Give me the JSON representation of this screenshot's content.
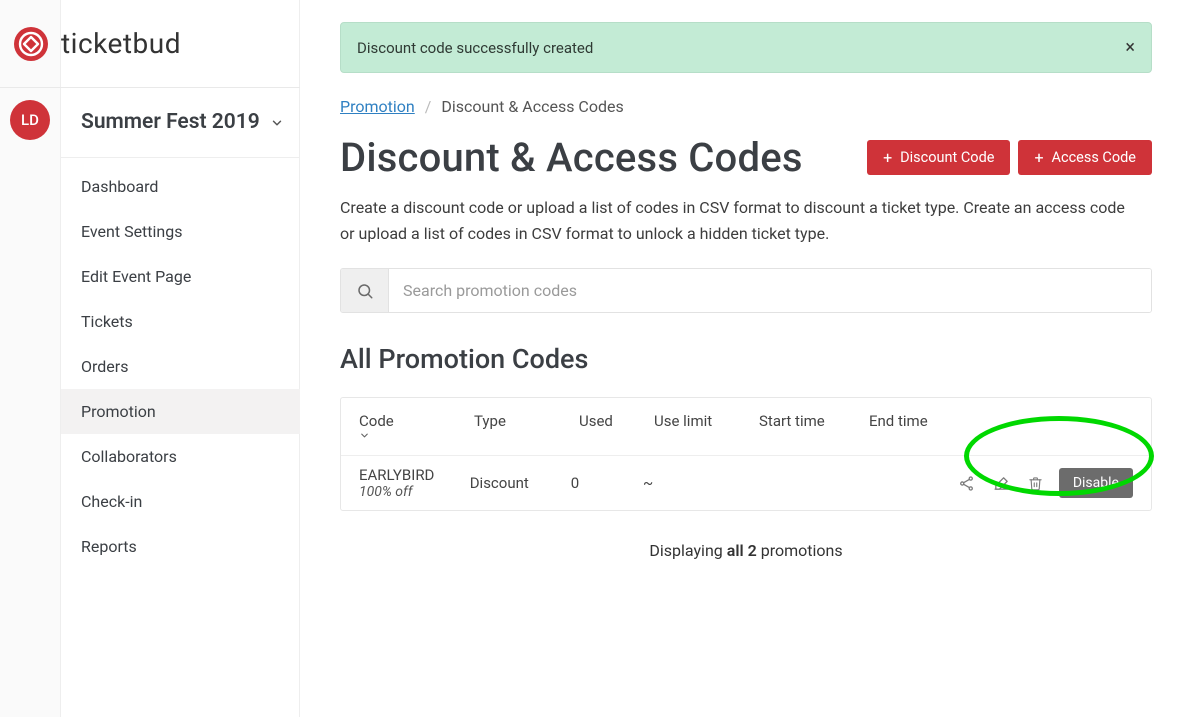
{
  "brand": {
    "name": "ticketbud"
  },
  "user": {
    "initials": "LD"
  },
  "event_switcher": {
    "title": "Summer Fest 2019"
  },
  "sidebar": {
    "items": [
      {
        "label": "Dashboard",
        "active": false
      },
      {
        "label": "Event Settings",
        "active": false
      },
      {
        "label": "Edit Event Page",
        "active": false
      },
      {
        "label": "Tickets",
        "active": false
      },
      {
        "label": "Orders",
        "active": false
      },
      {
        "label": "Promotion",
        "active": true
      },
      {
        "label": "Collaborators",
        "active": false
      },
      {
        "label": "Check-in",
        "active": false
      },
      {
        "label": "Reports",
        "active": false
      }
    ]
  },
  "flash": {
    "message": "Discount code successfully created"
  },
  "breadcrumb": {
    "link": "Promotion",
    "sep": "/",
    "current": "Discount & Access Codes"
  },
  "page": {
    "title": "Discount & Access Codes",
    "description": "Create a discount code or upload a list of codes in CSV format to discount a ticket type. Create an access code or upload a list of codes in CSV format to unlock a hidden ticket type."
  },
  "buttons": {
    "discount": "Discount Code",
    "access": "Access Code"
  },
  "search": {
    "placeholder": "Search promotion codes"
  },
  "section": {
    "title": "All Promotion Codes"
  },
  "table": {
    "headers": {
      "code": "Code",
      "type": "Type",
      "used": "Used",
      "use_limit": "Use limit",
      "start_time": "Start time",
      "end_time": "End time"
    },
    "rows": [
      {
        "code": "EARLYBIRD",
        "sub": "100% off",
        "type": "Discount",
        "used": "0",
        "use_limit": "~",
        "start_time": "",
        "end_time": "",
        "disable_label": "Disable"
      }
    ]
  },
  "pager": {
    "prefix": "Displaying ",
    "bold": "all 2",
    "suffix": " promotions"
  }
}
